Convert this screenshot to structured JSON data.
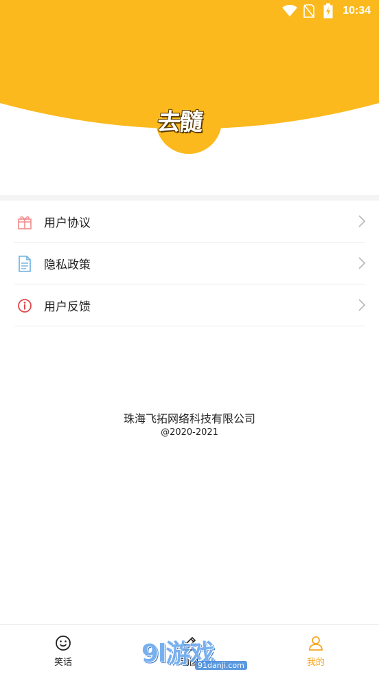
{
  "status_bar": {
    "time": "10:34",
    "icons": [
      "wifi-icon",
      "no-sim-icon",
      "battery-charging-icon"
    ]
  },
  "header": {
    "logo_text": "去髓",
    "accent_color": "#fbb91d"
  },
  "menu": {
    "items": [
      {
        "label": "用户协议",
        "icon": "gift-icon"
      },
      {
        "label": "隐私政策",
        "icon": "document-icon"
      },
      {
        "label": "用户反馈",
        "icon": "info-icon"
      }
    ]
  },
  "footer": {
    "company": "珠海飞拓网络科技有限公司",
    "copyright": "@2020-2021"
  },
  "tabbar": {
    "tabs": [
      {
        "label": "笑话",
        "icon": "smile-icon",
        "active": false
      },
      {
        "label": "动图",
        "icon": "pencil-icon",
        "active": false
      },
      {
        "label": "我的",
        "icon": "person-icon",
        "active": true
      }
    ],
    "active_color": "#f5a623"
  },
  "watermark": {
    "main": "9l游戏",
    "sub": "91danji.com"
  }
}
